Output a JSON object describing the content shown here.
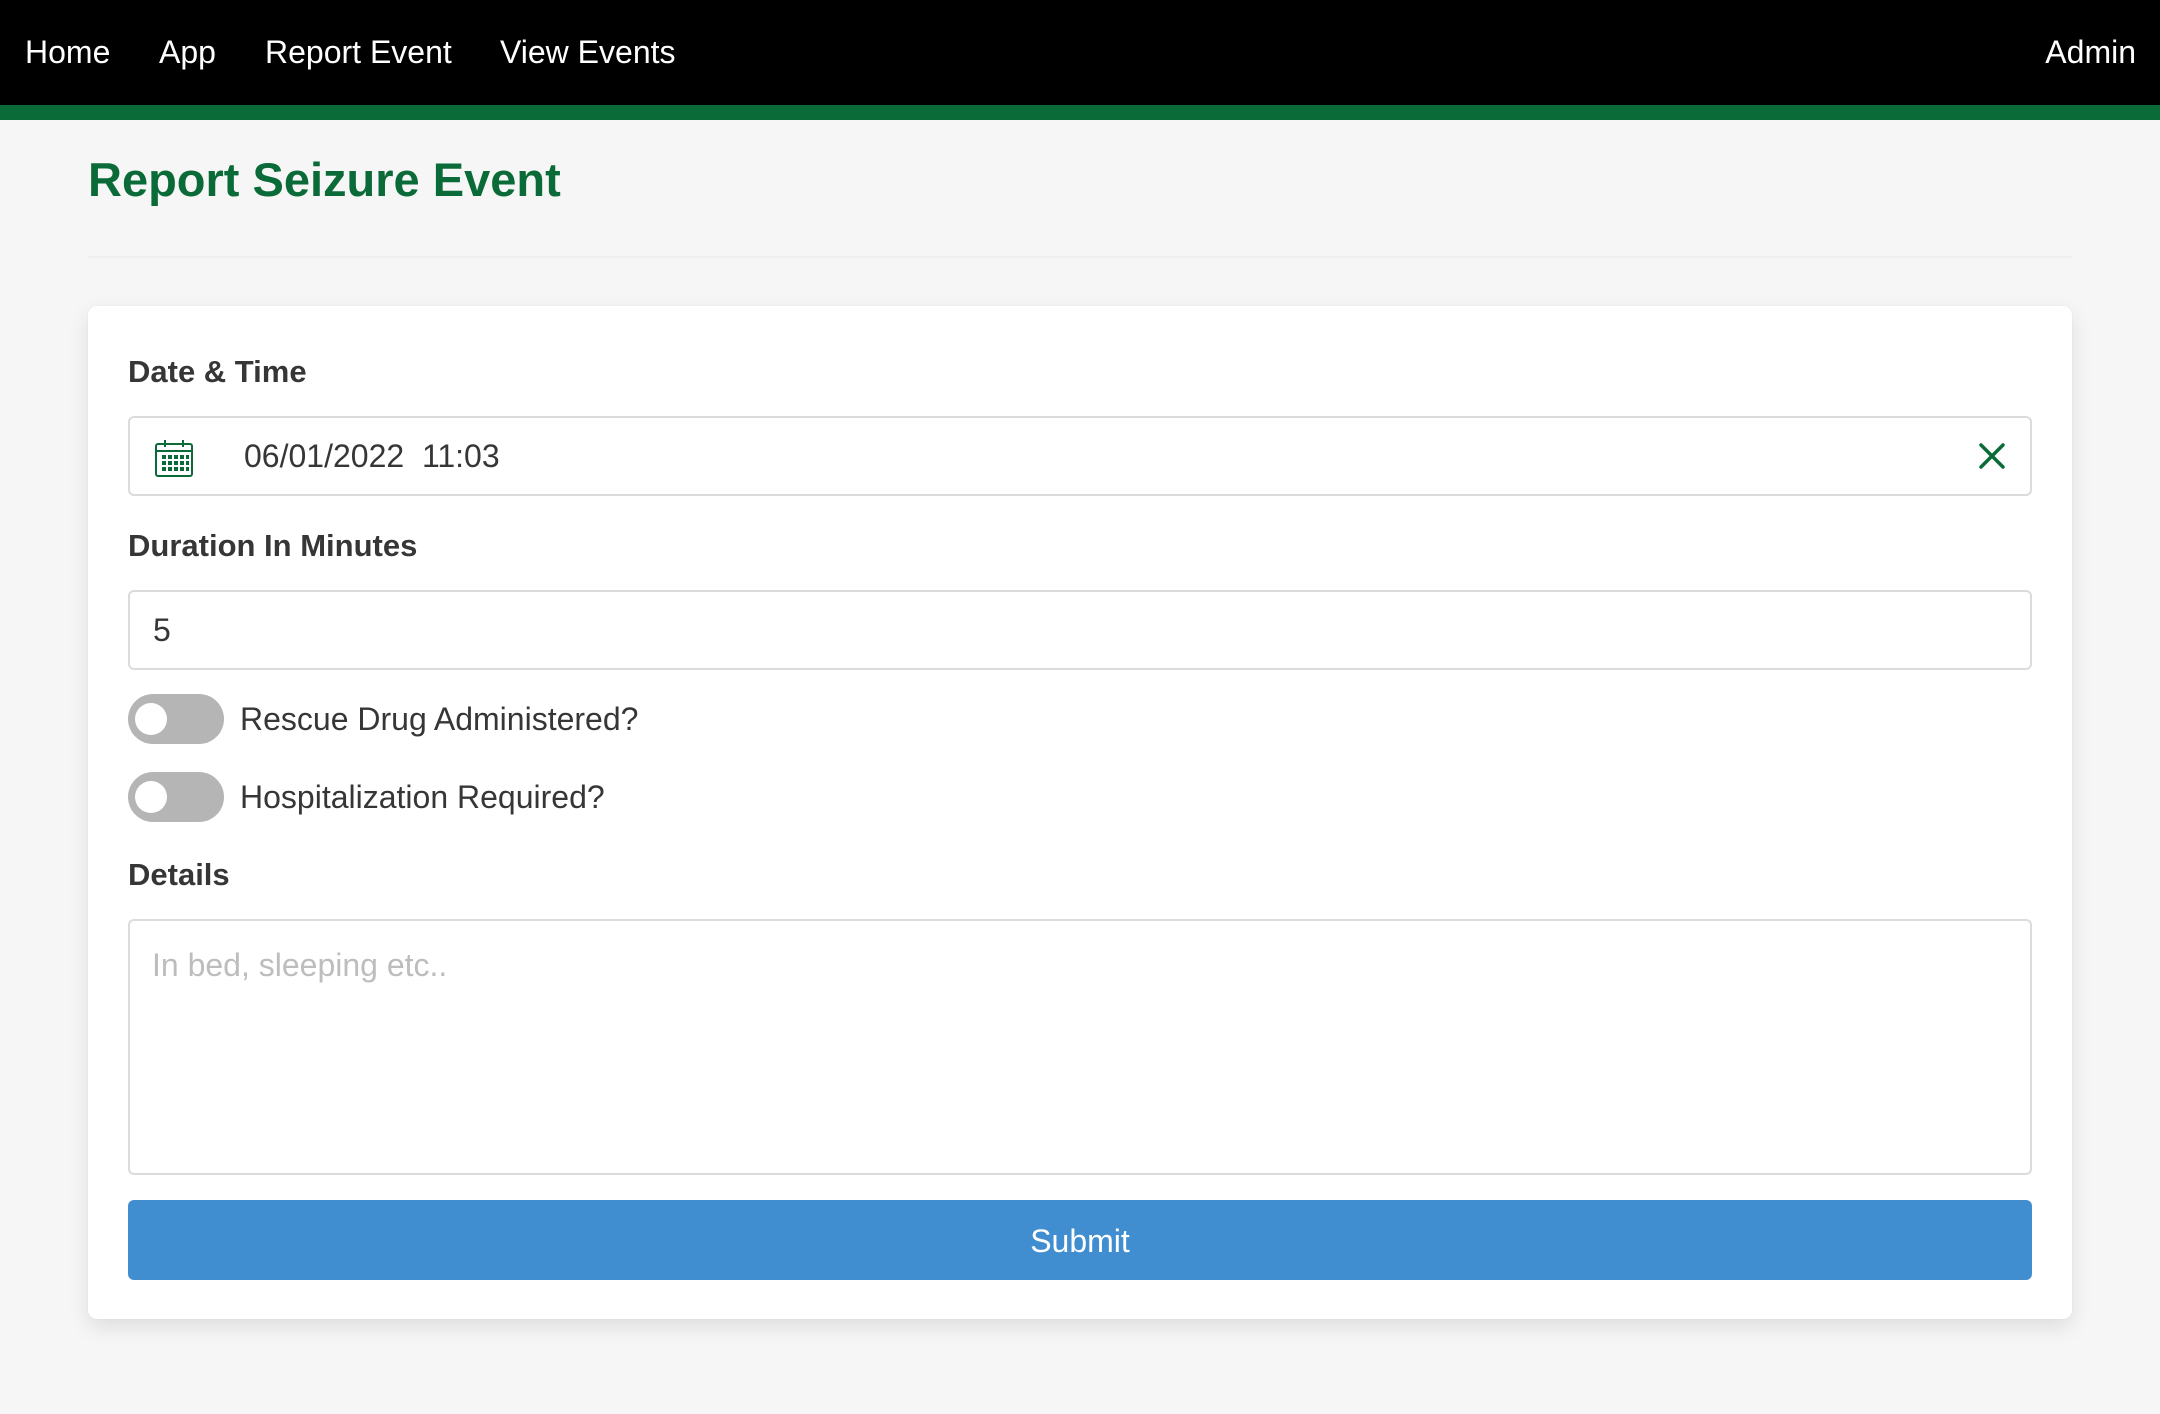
{
  "nav": {
    "items": [
      {
        "label": "Home"
      },
      {
        "label": "App"
      },
      {
        "label": "Report Event"
      },
      {
        "label": "View Events"
      }
    ],
    "admin_label": "Admin"
  },
  "page": {
    "title": "Report Seizure Event"
  },
  "form": {
    "datetime": {
      "label": "Date & Time",
      "date": "06/01/2022",
      "time": "11:03",
      "icon": "calendar-icon",
      "clear_icon": "close-icon"
    },
    "duration": {
      "label": "Duration In Minutes",
      "value": "5"
    },
    "toggles": [
      {
        "label": "Rescue Drug Administered?",
        "checked": false
      },
      {
        "label": "Hospitalization Required?",
        "checked": false
      }
    ],
    "details": {
      "label": "Details",
      "placeholder": "In bed, sleeping etc..",
      "value": ""
    },
    "submit_label": "Submit"
  },
  "colors": {
    "brand_green": "#0b6b38",
    "navbar_bg": "#000000",
    "submit_blue": "#408ed0",
    "toggle_off": "#b5b5b5"
  }
}
